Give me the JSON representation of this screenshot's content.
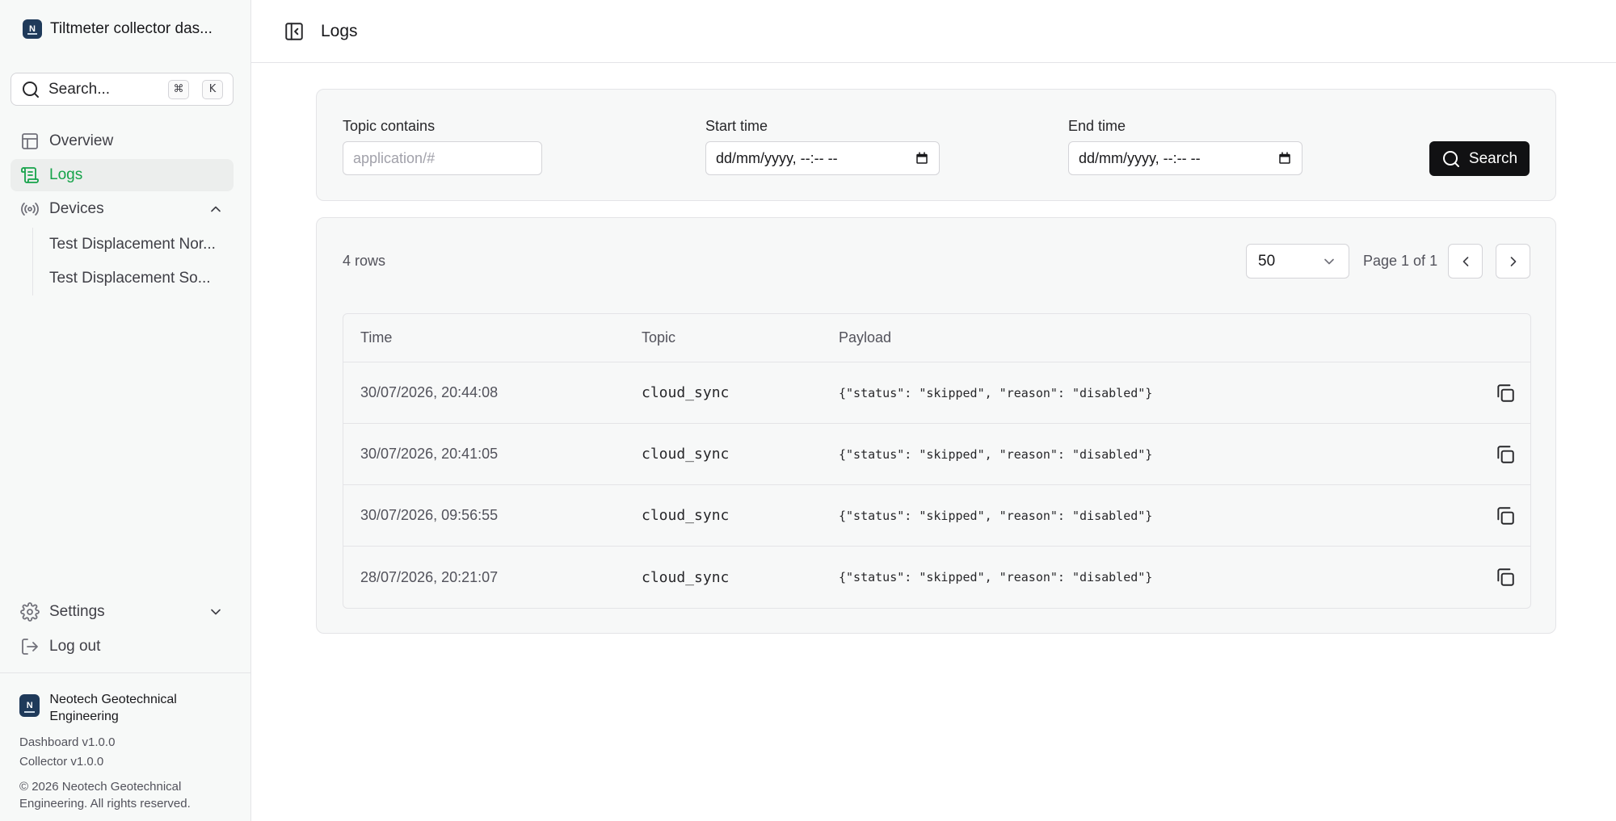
{
  "sidebar": {
    "brand": {
      "logo_letter": "N",
      "name": "Tiltmeter collector das..."
    },
    "search": {
      "label": "Search...",
      "shortcut_cmd": "⌘",
      "shortcut_key": "K"
    },
    "nav": {
      "overview": "Overview",
      "logs": "Logs",
      "devices": "Devices"
    },
    "devices": [
      "Test Displacement Nor...",
      "Test Displacement So..."
    ],
    "settings": "Settings",
    "logout": "Log out",
    "footer": {
      "logo_letter": "N",
      "org_name": "Neotech Geotechnical Engineering",
      "dashboard_version": "Dashboard v1.0.0",
      "collector_version": "Collector v1.0.0",
      "copyright": "© 2026 Neotech Geotechnical Engineering. All rights reserved."
    }
  },
  "header": {
    "title": "Logs"
  },
  "filters": {
    "topic_label": "Topic contains",
    "topic_placeholder": "application/#",
    "start_label": "Start time",
    "start_value": "dd/mm/yyyy, --:-- --",
    "end_label": "End time",
    "end_value": "dd/mm/yyyy, --:-- --",
    "search_label": "Search"
  },
  "results": {
    "rows_count": "4 rows",
    "page_size": "50",
    "page_text": "Page 1 of 1",
    "columns": {
      "time": "Time",
      "topic": "Topic",
      "payload": "Payload"
    },
    "rows": [
      {
        "time": "30/07/2026, 20:44:08",
        "topic": "cloud_sync",
        "payload": "{\"status\": \"skipped\", \"reason\": \"disabled\"}"
      },
      {
        "time": "30/07/2026, 20:41:05",
        "topic": "cloud_sync",
        "payload": "{\"status\": \"skipped\", \"reason\": \"disabled\"}"
      },
      {
        "time": "30/07/2026, 09:56:55",
        "topic": "cloud_sync",
        "payload": "{\"status\": \"skipped\", \"reason\": \"disabled\"}"
      },
      {
        "time": "28/07/2026, 20:21:07",
        "topic": "cloud_sync",
        "payload": "{\"status\": \"skipped\", \"reason\": \"disabled\"}"
      }
    ]
  },
  "colors": {
    "accent": "#16a34a",
    "brand": "#1f3a5a",
    "button": "#111113"
  },
  "icons": [
    "search-icon",
    "layout-icon",
    "scroll-icon",
    "radio-tower-icon",
    "chevron-up-icon",
    "gear-icon",
    "chevron-down-icon",
    "log-out-icon",
    "sidebar-toggle-icon",
    "chevron-left-icon",
    "chevron-right-icon",
    "copy-icon",
    "calendar-icon"
  ]
}
